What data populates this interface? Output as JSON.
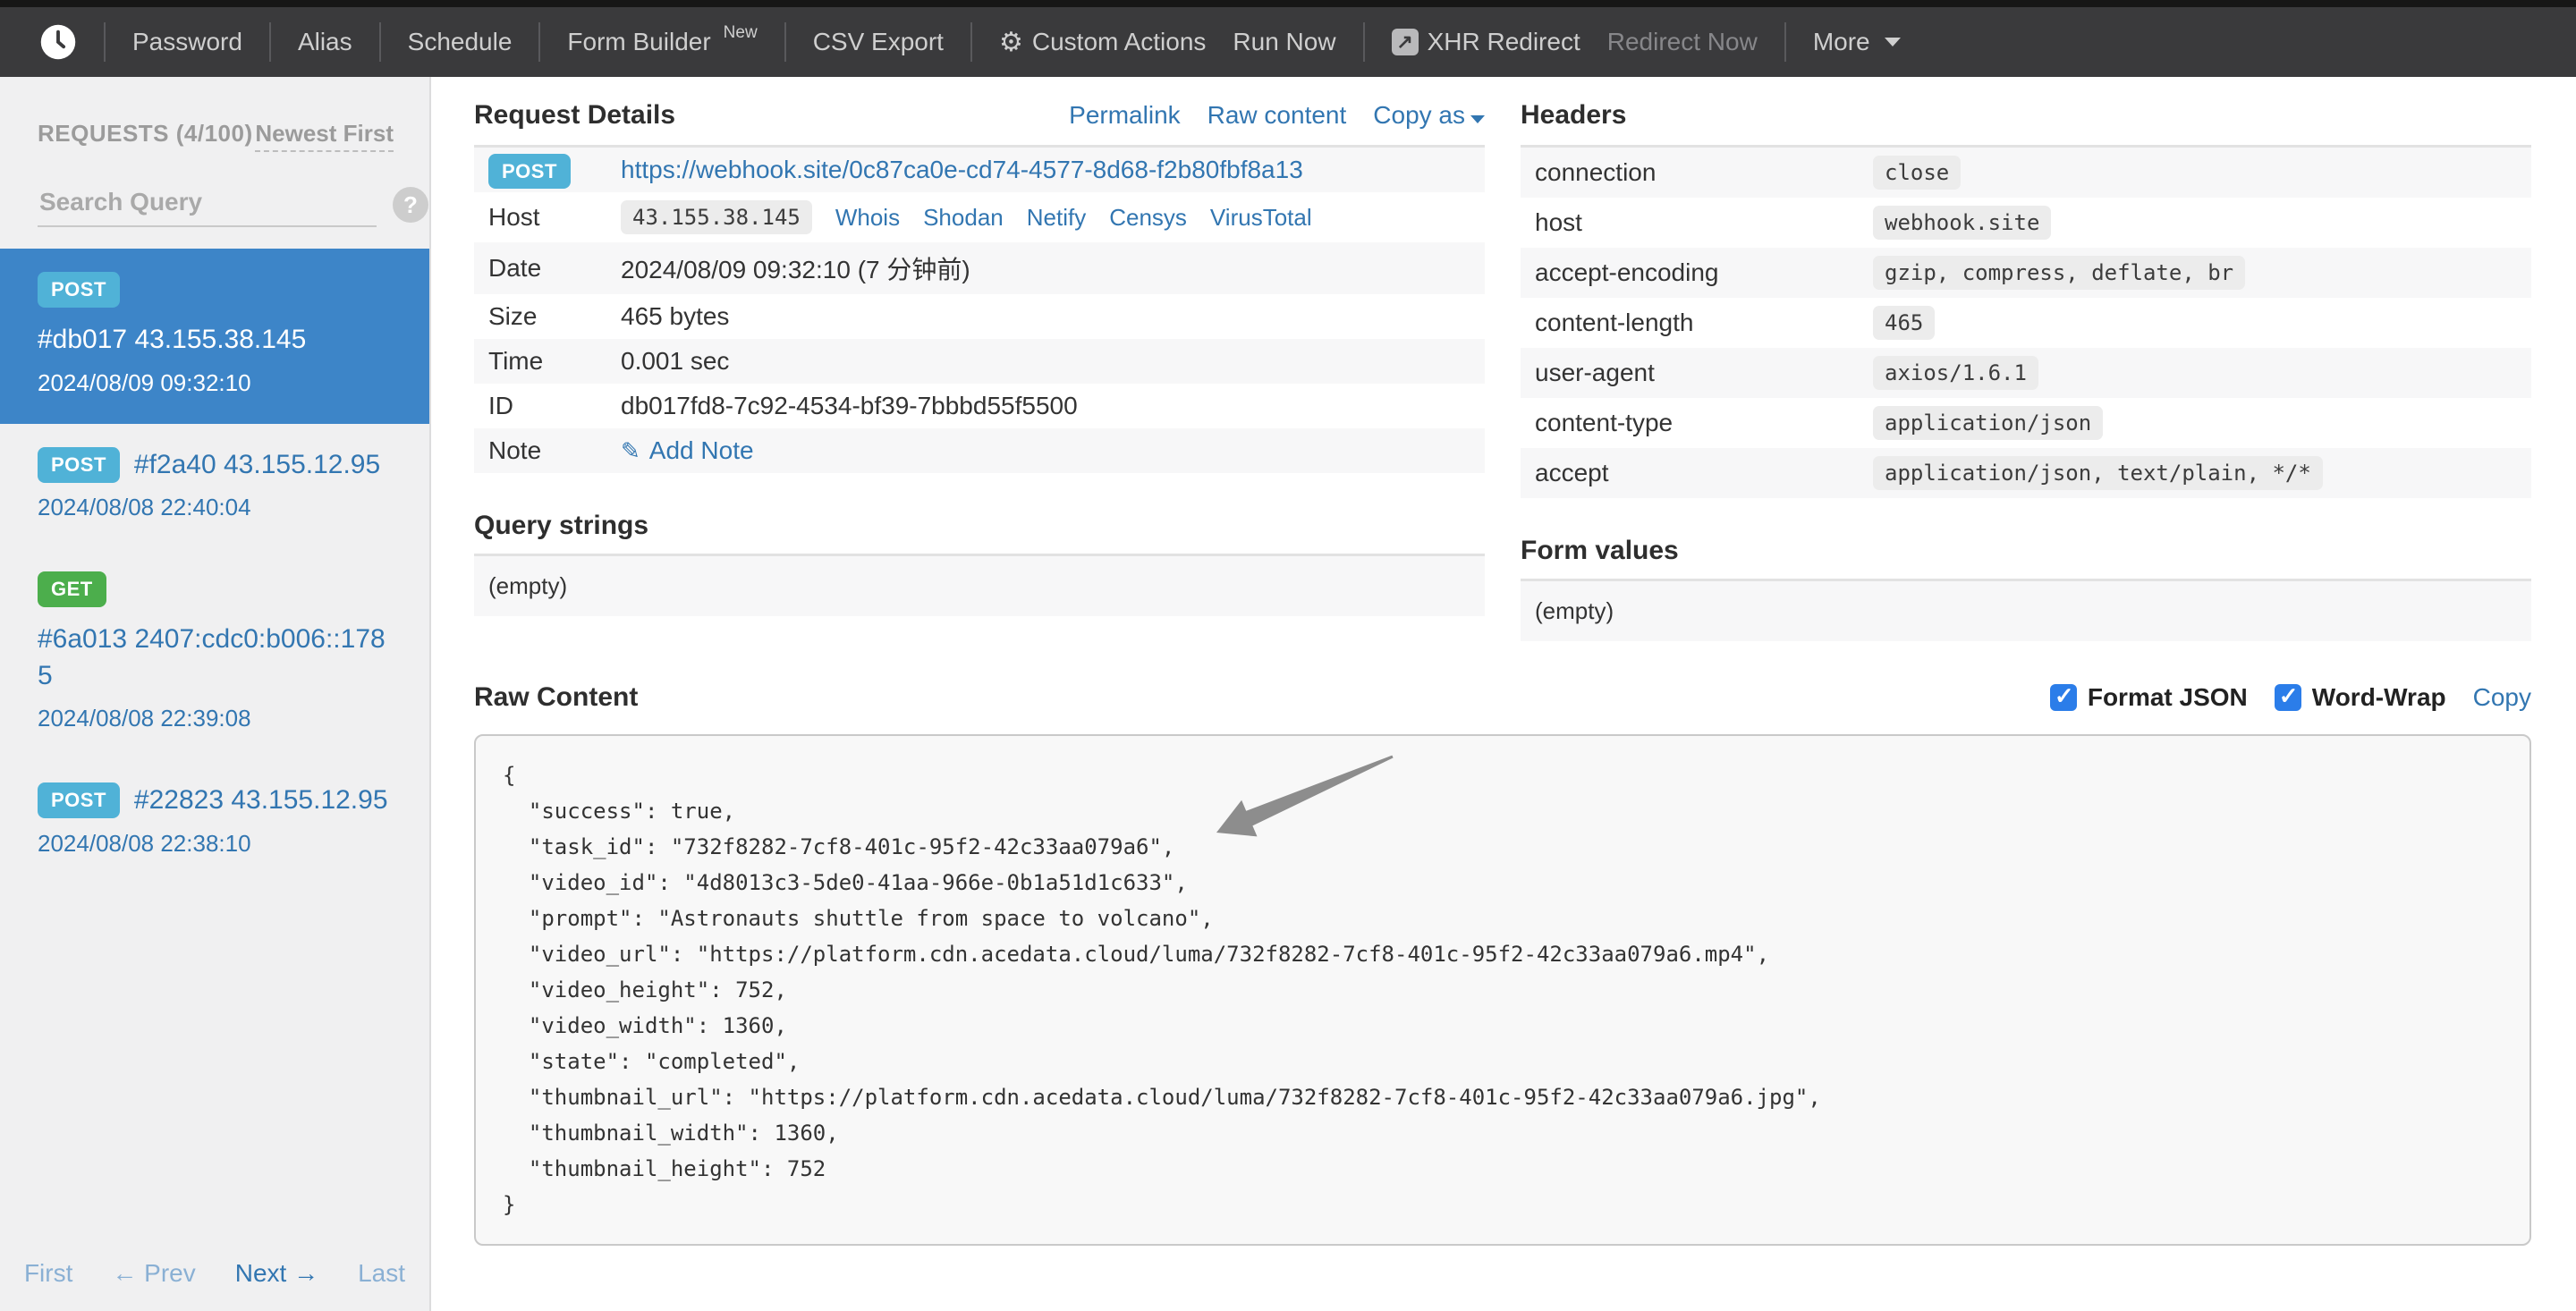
{
  "navbar": {
    "items": [
      {
        "label": "Password"
      },
      {
        "label": "Alias"
      },
      {
        "label": "Schedule"
      },
      {
        "label": "Form Builder",
        "badge": "New"
      },
      {
        "label": "CSV Export"
      },
      {
        "label": "Custom Actions"
      },
      {
        "label": "Run Now"
      },
      {
        "label": "XHR Redirect"
      },
      {
        "label": "Redirect Now"
      },
      {
        "label": "More"
      }
    ]
  },
  "sidebar": {
    "requests_label": "REQUESTS (4/100)",
    "sort_label": "Newest First",
    "search_placeholder": "Search Query",
    "help_icon": "?",
    "requests": [
      {
        "method": "POST",
        "title": "#db017 43.155.38.145",
        "date": "2024/08/09 09:32:10",
        "selected": true
      },
      {
        "method": "POST",
        "title": "#f2a40 43.155.12.95",
        "date": "2024/08/08 22:40:04",
        "selected": false
      },
      {
        "method": "GET",
        "title": "#6a013 2407:cdc0:b006::1785",
        "date": "2024/08/08 22:39:08",
        "selected": false
      },
      {
        "method": "POST",
        "title": "#22823 43.155.12.95",
        "date": "2024/08/08 22:38:10",
        "selected": false
      }
    ],
    "pagination": {
      "first": "First",
      "prev": "← Prev",
      "next": "Next →",
      "last": "Last"
    }
  },
  "request_details": {
    "title": "Request Details",
    "permalink": "Permalink",
    "raw_content_link": "Raw content",
    "copy_as": "Copy as",
    "method": "POST",
    "url": "https://webhook.site/0c87ca0e-cd74-4577-8d68-f2b80fbf8a13",
    "host_label": "Host",
    "host_value": "43.155.38.145",
    "host_links": [
      "Whois",
      "Shodan",
      "Netify",
      "Censys",
      "VirusTotal"
    ],
    "date_label": "Date",
    "date_value": "2024/08/09 09:32:10 (7 分钟前)",
    "size_label": "Size",
    "size_value": "465 bytes",
    "time_label": "Time",
    "time_value": "0.001 sec",
    "id_label": "ID",
    "id_value": "db017fd8-7c92-4534-bf39-7bbbd55f5500",
    "note_label": "Note",
    "note_action": "Add Note"
  },
  "headers": {
    "title": "Headers",
    "rows": [
      {
        "name": "connection",
        "value": "close"
      },
      {
        "name": "host",
        "value": "webhook.site"
      },
      {
        "name": "accept-encoding",
        "value": "gzip, compress, deflate, br"
      },
      {
        "name": "content-length",
        "value": "465"
      },
      {
        "name": "user-agent",
        "value": "axios/1.6.1"
      },
      {
        "name": "content-type",
        "value": "application/json"
      },
      {
        "name": "accept",
        "value": "application/json, text/plain, */*"
      }
    ]
  },
  "query_strings": {
    "title": "Query strings",
    "empty": "(empty)"
  },
  "form_values": {
    "title": "Form values",
    "empty": "(empty)"
  },
  "raw_content": {
    "title": "Raw Content",
    "format_json_label": "Format JSON",
    "format_json_checked": true,
    "word_wrap_label": "Word-Wrap",
    "word_wrap_checked": true,
    "copy_label": "Copy",
    "body": "{\n  \"success\": true,\n  \"task_id\": \"732f8282-7cf8-401c-95f2-42c33aa079a6\",\n  \"video_id\": \"4d8013c3-5de0-41aa-966e-0b1a51d1c633\",\n  \"prompt\": \"Astronauts shuttle from space to volcano\",\n  \"video_url\": \"https://platform.cdn.acedata.cloud/luma/732f8282-7cf8-401c-95f2-42c33aa079a6.mp4\",\n  \"video_height\": 752,\n  \"video_width\": 1360,\n  \"state\": \"completed\",\n  \"thumbnail_url\": \"https://platform.cdn.acedata.cloud/luma/732f8282-7cf8-401c-95f2-42c33aa079a6.jpg\",\n  \"thumbnail_width\": 1360,\n  \"thumbnail_height\": 752\n}"
  },
  "colors": {
    "navbar_bg": "#3a3a3c",
    "selected_blue": "#3d85c8",
    "post_badge": "#50b2d7",
    "get_badge": "#4cae4c",
    "link_blue": "#3276b1",
    "checkbox_blue": "#2b7de9"
  }
}
